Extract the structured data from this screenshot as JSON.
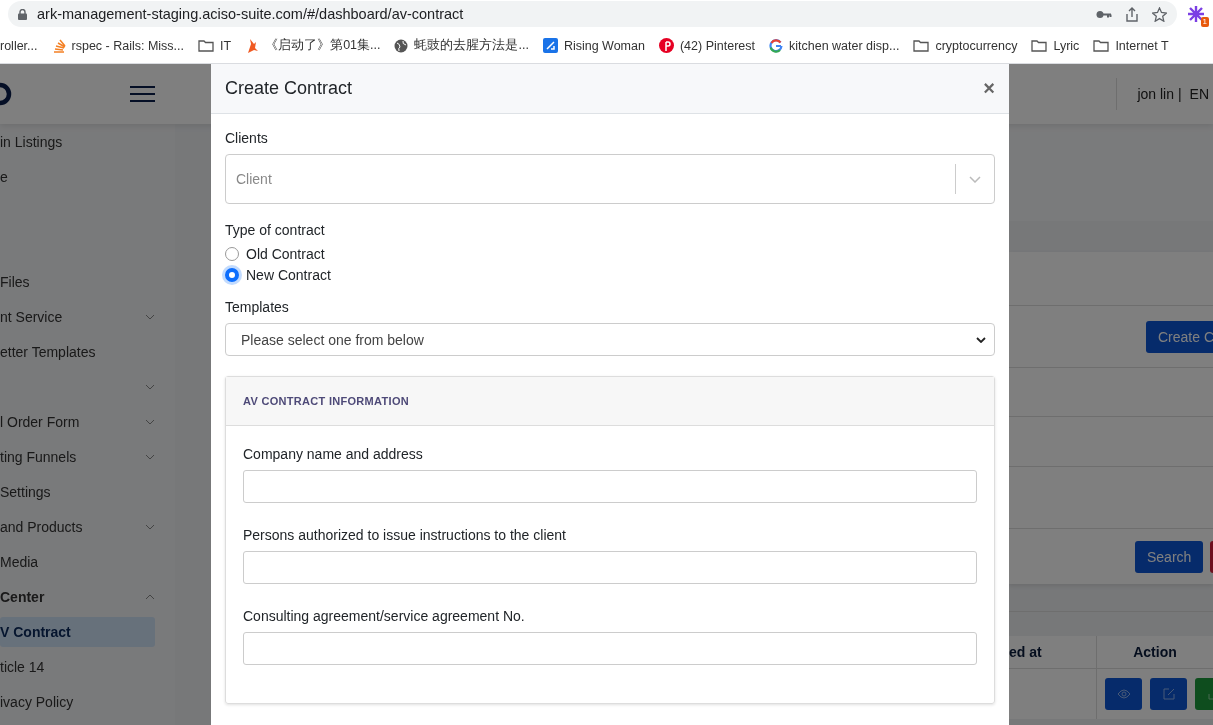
{
  "browser": {
    "url": "ark-management-staging.aciso-suite.com/#/dashboard/av-contract",
    "extension_badge": "1",
    "bookmarks": [
      {
        "label": "roller...",
        "kind": "plain"
      },
      {
        "label": "rspec - Rails: Miss...",
        "kind": "stack"
      },
      {
        "label": "IT",
        "kind": "folder"
      },
      {
        "label": "《启动了》第01集...",
        "kind": "flame"
      },
      {
        "label": "蚝豉的去腥方法是...",
        "kind": "globe"
      },
      {
        "label": "Rising Woman",
        "kind": "square"
      },
      {
        "label": "(42) Pinterest",
        "kind": "pin"
      },
      {
        "label": "kitchen water disp...",
        "kind": "google"
      },
      {
        "label": "cryptocurrency",
        "kind": "folder"
      },
      {
        "label": "Lyric",
        "kind": "folder"
      },
      {
        "label": "Internet T",
        "kind": "folder"
      }
    ]
  },
  "header": {
    "user": "jon lin |",
    "language": "EN"
  },
  "sidebar": {
    "top_items": [
      {
        "label": "in Listings",
        "kind": "link",
        "selected": false
      },
      {
        "label": "e",
        "kind": "link",
        "selected": false
      }
    ],
    "items": [
      {
        "label": " Files",
        "kind": "link",
        "selected": false
      },
      {
        "label": "nt Service",
        "kind": "group",
        "expanded": false
      },
      {
        "label": "etter Templates",
        "kind": "link",
        "selected": false
      },
      {
        "kind": "group",
        "expanded": false
      },
      {
        "label": "l Order Form",
        "kind": "group",
        "expanded": false
      },
      {
        "label": "ting Funnels",
        "kind": "group",
        "expanded": false
      },
      {
        "label": "Settings",
        "kind": "link",
        "selected": false
      },
      {
        "label": "and Products",
        "kind": "group",
        "expanded": false
      },
      {
        "label": " Media",
        "kind": "link",
        "selected": false
      },
      {
        "label": "Center",
        "kind": "group",
        "expanded": true
      },
      {
        "label": "V Contract",
        "kind": "link",
        "selected": true
      },
      {
        "label": "ticle 14",
        "kind": "link",
        "selected": false
      },
      {
        "label": "ivacy Policy",
        "kind": "link",
        "selected": false
      }
    ]
  },
  "main": {
    "create_button": "Create C",
    "search_button": "Search",
    "table": {
      "columns": [
        "ed at",
        "Action"
      ],
      "rows": [
        {
          "actions": [
            {
              "kind": "view"
            },
            {
              "kind": "edit"
            },
            {
              "kind": "download"
            }
          ]
        }
      ]
    }
  },
  "modal": {
    "title": "Create Contract",
    "close": "×",
    "clients": {
      "label": "Clients",
      "placeholder": "Client"
    },
    "contract_type": {
      "label": "Type of contract",
      "options": [
        {
          "label": "Old Contract",
          "selected": false
        },
        {
          "label": "New Contract",
          "selected": true
        }
      ]
    },
    "templates": {
      "label": "Templates",
      "value": "Please select one from below"
    },
    "section": {
      "title": "AV CONTRACT INFORMATION",
      "fields": [
        {
          "label": "Company name and address"
        },
        {
          "label": "Persons authorized to issue instructions to the client"
        },
        {
          "label": "Consulting agreement/service agreement No."
        }
      ]
    }
  }
}
